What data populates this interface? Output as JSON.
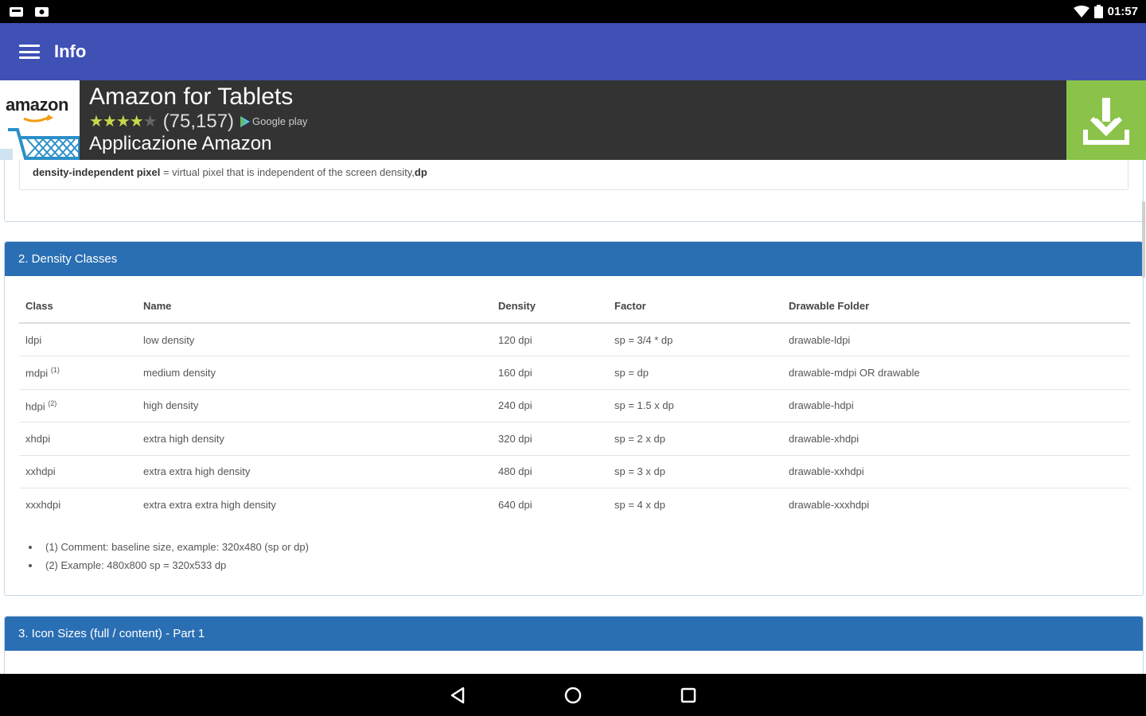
{
  "status_bar": {
    "time": "01:57"
  },
  "app_bar": {
    "title": "Info",
    "menu_icon": "hamburger-menu-icon"
  },
  "ad": {
    "logo_text": "amazon",
    "title": "Amazon for Tablets",
    "stars": "★★★★",
    "star_empty": "★",
    "rating_count": "(75,157)",
    "store": "Google play",
    "subtitle": "Applicazione Amazon",
    "brand_color": "#8BC34A"
  },
  "section1": {
    "term": "density-independent pixel",
    "definition": " = virtual pixel that is independent of the screen density,",
    "abbr": "dp"
  },
  "section2": {
    "title": "2. Density Classes",
    "header_color": "#2a6fb3",
    "columns": [
      "Class",
      "Name",
      "Density",
      "Factor",
      "Drawable Folder"
    ],
    "rows": [
      {
        "class": "ldpi",
        "sup": "",
        "name": "low density",
        "density": "120 dpi",
        "factor": "sp = 3/4 * dp",
        "folder": "drawable-ldpi"
      },
      {
        "class": "mdpi",
        "sup": "(1)",
        "name": "medium density",
        "density": "160 dpi",
        "factor": "sp = dp",
        "folder": "drawable-mdpi OR drawable"
      },
      {
        "class": "hdpi",
        "sup": "(2)",
        "name": "high density",
        "density": "240 dpi",
        "factor": "sp = 1.5 x dp",
        "folder": "drawable-hdpi"
      },
      {
        "class": "xhdpi",
        "sup": "",
        "name": "extra high density",
        "density": "320 dpi",
        "factor": "sp = 2 x dp",
        "folder": "drawable-xhdpi"
      },
      {
        "class": "xxhdpi",
        "sup": "",
        "name": "extra extra high density",
        "density": "480 dpi",
        "factor": "sp = 3 x dp",
        "folder": "drawable-xxhdpi"
      },
      {
        "class": "xxxhdpi",
        "sup": "",
        "name": "extra extra extra high density",
        "density": "640 dpi",
        "factor": "sp = 4 x dp",
        "folder": "drawable-xxxhdpi"
      }
    ],
    "notes": [
      "(1) Comment: baseline size, example: 320x480 (sp or dp)",
      "(2) Example: 480x800 sp = 320x533 dp"
    ]
  },
  "section3": {
    "title": "3. Icon Sizes (full / content) - Part 1"
  },
  "nav_bar": {
    "back": "back-icon",
    "home": "home-icon",
    "recents": "recents-icon"
  }
}
